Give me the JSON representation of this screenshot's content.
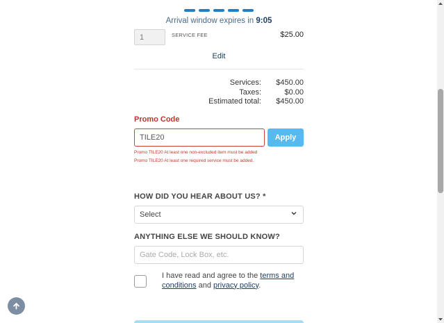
{
  "progress": {
    "steps_total": 5,
    "steps_done": 5,
    "accent": "#1f7fc7"
  },
  "arrival": {
    "text": "Arrival window expires in",
    "time": "9:05"
  },
  "line_item": {
    "quantity": "1",
    "name": "SERVICE FEE",
    "price": "$25.00"
  },
  "edit_label": "Edit",
  "totals": [
    {
      "label": "Services:",
      "value": "$450.00"
    },
    {
      "label": "Taxes:",
      "value": "$0.00"
    },
    {
      "label": "Estimated total:",
      "value": "$450.00"
    }
  ],
  "promo": {
    "title": "Promo Code",
    "value": "TILE20",
    "apply_label": "Apply",
    "errors": [
      "Promo TILE20 At least one non-excluded item must be added",
      "Promo TILE20 At least one required service must be added."
    ],
    "error_color": "#c0392b"
  },
  "hear_about": {
    "label": "HOW DID YOU HEAR ABOUT US? *",
    "selected": "Select"
  },
  "anything_else": {
    "label": "ANYTHING ELSE WE SHOULD KNOW?",
    "placeholder": "Gate Code, Lock Box, etc."
  },
  "agreement": {
    "prefix": "I have read and agree to the",
    "terms_label": "terms and conditions",
    "middle": "and",
    "privacy_label": "privacy policy",
    "suffix": "."
  },
  "icons": {
    "scroll_top": "arrow-up-icon",
    "select_chevron": "chevron-down-icon"
  }
}
